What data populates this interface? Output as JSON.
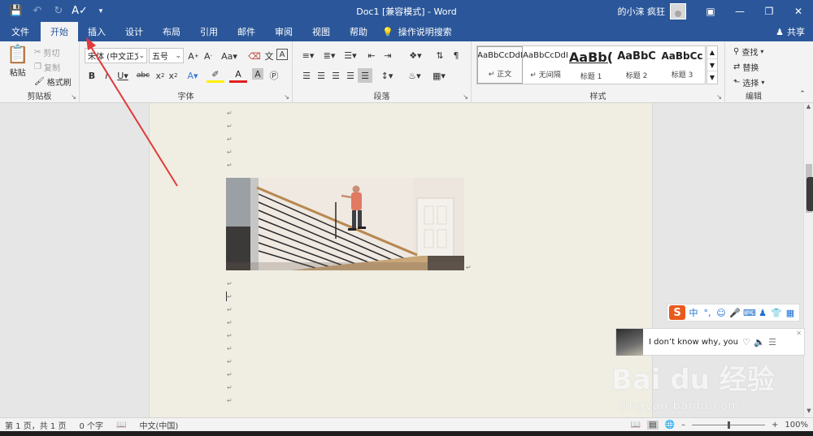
{
  "window": {
    "title": "Doc1 [兼容模式]  -  Word",
    "user": "的小涞 疯狂",
    "colors": {
      "accent": "#2b579a",
      "ribbon": "#f3f3f3",
      "page": "#f0ede2",
      "annotation": "#e03a3a"
    }
  },
  "qat": {
    "icons": [
      "save-icon",
      "undo-icon",
      "redo-icon",
      "spelling-icon",
      "customize-icon"
    ]
  },
  "tabs": [
    "文件",
    "开始",
    "插入",
    "设计",
    "布局",
    "引用",
    "邮件",
    "审阅",
    "视图",
    "帮助"
  ],
  "active_tab": "开始",
  "tell_me": "操作说明搜索",
  "share": "共享",
  "ribbon": {
    "clipboard": {
      "label": "剪贴板",
      "paste": "粘贴",
      "cut": "剪切",
      "copy": "复制",
      "format_painter": "格式刷"
    },
    "font": {
      "label": "字体",
      "font_name": "宋体 (中文正文",
      "font_size": "五号"
    },
    "paragraph": {
      "label": "段落"
    },
    "styles": {
      "label": "样式",
      "items": [
        {
          "sample": "AaBbCcDdI",
          "name": "↵ 正文"
        },
        {
          "sample": "AaBbCcDdI",
          "name": "↵ 无间隔"
        },
        {
          "sample": "AaBb(",
          "name": "标题 1"
        },
        {
          "sample": "AaBbC",
          "name": "标题 2"
        },
        {
          "sample": "AaBbCc",
          "name": "标题 3"
        }
      ]
    },
    "editing": {
      "label": "编辑",
      "find": "查找",
      "replace": "替换",
      "select": "选择"
    }
  },
  "ime": {
    "mode": "中"
  },
  "music": {
    "song": "I don’t know why, you"
  },
  "watermark": {
    "brand": "Bai du 经验",
    "url": "jingyan.baidu.com"
  },
  "status": {
    "page": "第 1 页，共 1 页",
    "words": "0 个字",
    "language": "中文(中国)",
    "zoom": "100%",
    "zoom_level": 1.0
  }
}
